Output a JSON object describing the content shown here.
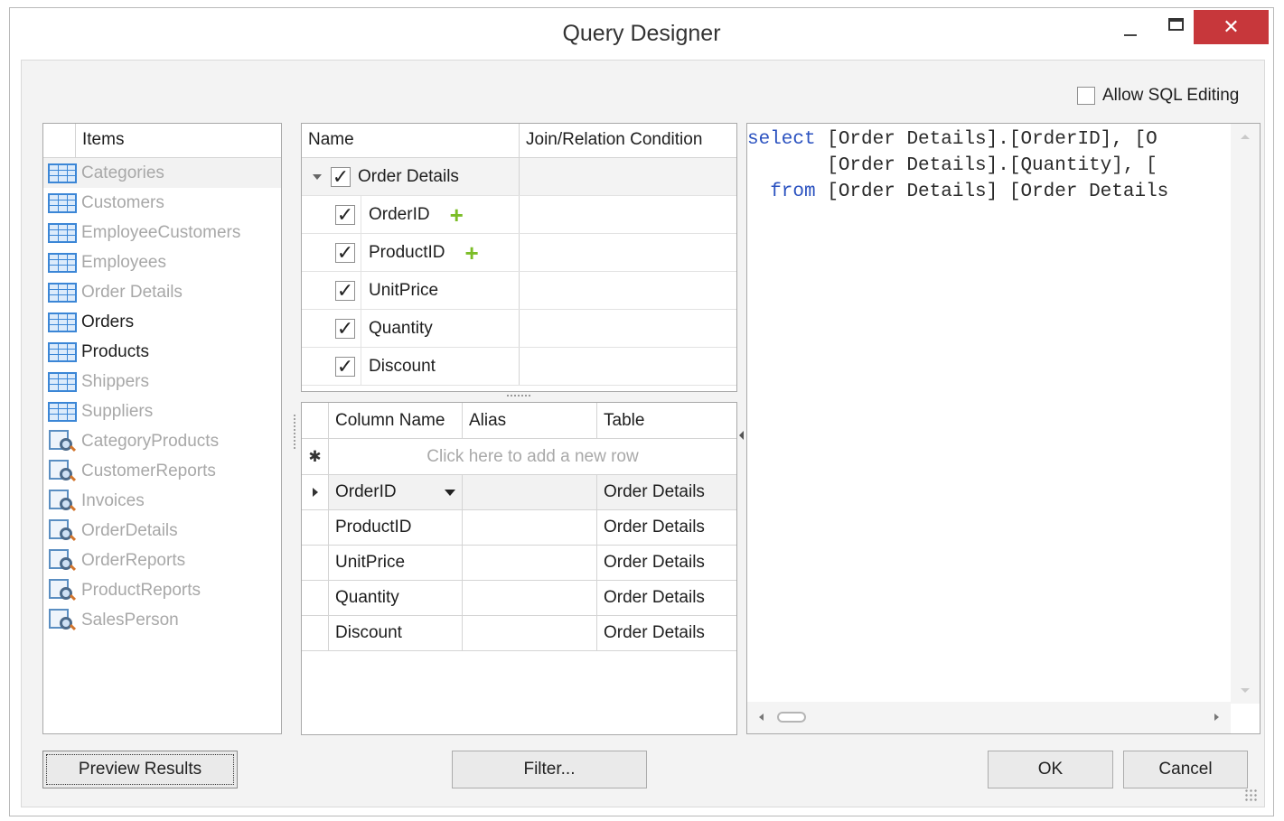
{
  "window": {
    "title": "Query Designer",
    "close_glyph": "✕"
  },
  "allow_sql": {
    "label": "Allow SQL Editing",
    "checked": false
  },
  "items_panel": {
    "header": "Items",
    "items": [
      {
        "label": "Categories",
        "icon": "table-icon",
        "state": "grey"
      },
      {
        "label": "Customers",
        "icon": "table-icon",
        "state": "grey"
      },
      {
        "label": "EmployeeCustomers",
        "icon": "table-icon",
        "state": "grey"
      },
      {
        "label": "Employees",
        "icon": "table-icon",
        "state": "grey"
      },
      {
        "label": "Order Details",
        "icon": "table-icon",
        "state": "grey"
      },
      {
        "label": "Orders",
        "icon": "table-icon",
        "state": "dark"
      },
      {
        "label": "Products",
        "icon": "table-icon",
        "state": "dark"
      },
      {
        "label": "Shippers",
        "icon": "table-icon",
        "state": "grey"
      },
      {
        "label": "Suppliers",
        "icon": "table-icon",
        "state": "grey"
      },
      {
        "label": "CategoryProducts",
        "icon": "view-icon",
        "state": "grey"
      },
      {
        "label": "CustomerReports",
        "icon": "view-icon",
        "state": "grey"
      },
      {
        "label": "Invoices",
        "icon": "view-icon",
        "state": "grey"
      },
      {
        "label": "OrderDetails",
        "icon": "view-icon",
        "state": "grey"
      },
      {
        "label": "OrderReports",
        "icon": "view-icon",
        "state": "grey"
      },
      {
        "label": "ProductReports",
        "icon": "view-icon",
        "state": "grey"
      },
      {
        "label": "SalesPerson",
        "icon": "view-icon",
        "state": "grey"
      }
    ]
  },
  "tree_panel": {
    "headers": {
      "name": "Name",
      "join": "Join/Relation Condition"
    },
    "parent": {
      "label": "Order Details",
      "checked": true
    },
    "children": [
      {
        "label": "OrderID",
        "checked": true,
        "has_plus": true
      },
      {
        "label": "ProductID",
        "checked": true,
        "has_plus": true
      },
      {
        "label": "UnitPrice",
        "checked": true,
        "has_plus": false
      },
      {
        "label": "Quantity",
        "checked": true,
        "has_plus": false
      },
      {
        "label": "Discount",
        "checked": true,
        "has_plus": false
      }
    ],
    "check_glyph": "✓",
    "plus_glyph": "+"
  },
  "grid_panel": {
    "headers": {
      "column": "Column Name",
      "alias": "Alias",
      "table": "Table"
    },
    "new_row_text": "Click here to add a new row",
    "new_row_glyph": "✱",
    "rows": [
      {
        "column": "OrderID",
        "alias": "",
        "table": "Order Details"
      },
      {
        "column": "ProductID",
        "alias": "",
        "table": "Order Details"
      },
      {
        "column": "UnitPrice",
        "alias": "",
        "table": "Order Details"
      },
      {
        "column": "Quantity",
        "alias": "",
        "table": "Order Details"
      },
      {
        "column": "Discount",
        "alias": "",
        "table": "Order Details"
      }
    ]
  },
  "sql": {
    "line1_kw": "select",
    "line1_rest": " [Order Details].[OrderID], [O",
    "line2": "       [Order Details].[Quantity], [",
    "line3_kw": "  from",
    "line3_rest": " [Order Details] [Order Details"
  },
  "buttons": {
    "preview": "Preview Results",
    "filter": "Filter...",
    "ok": "OK",
    "cancel": "Cancel"
  }
}
